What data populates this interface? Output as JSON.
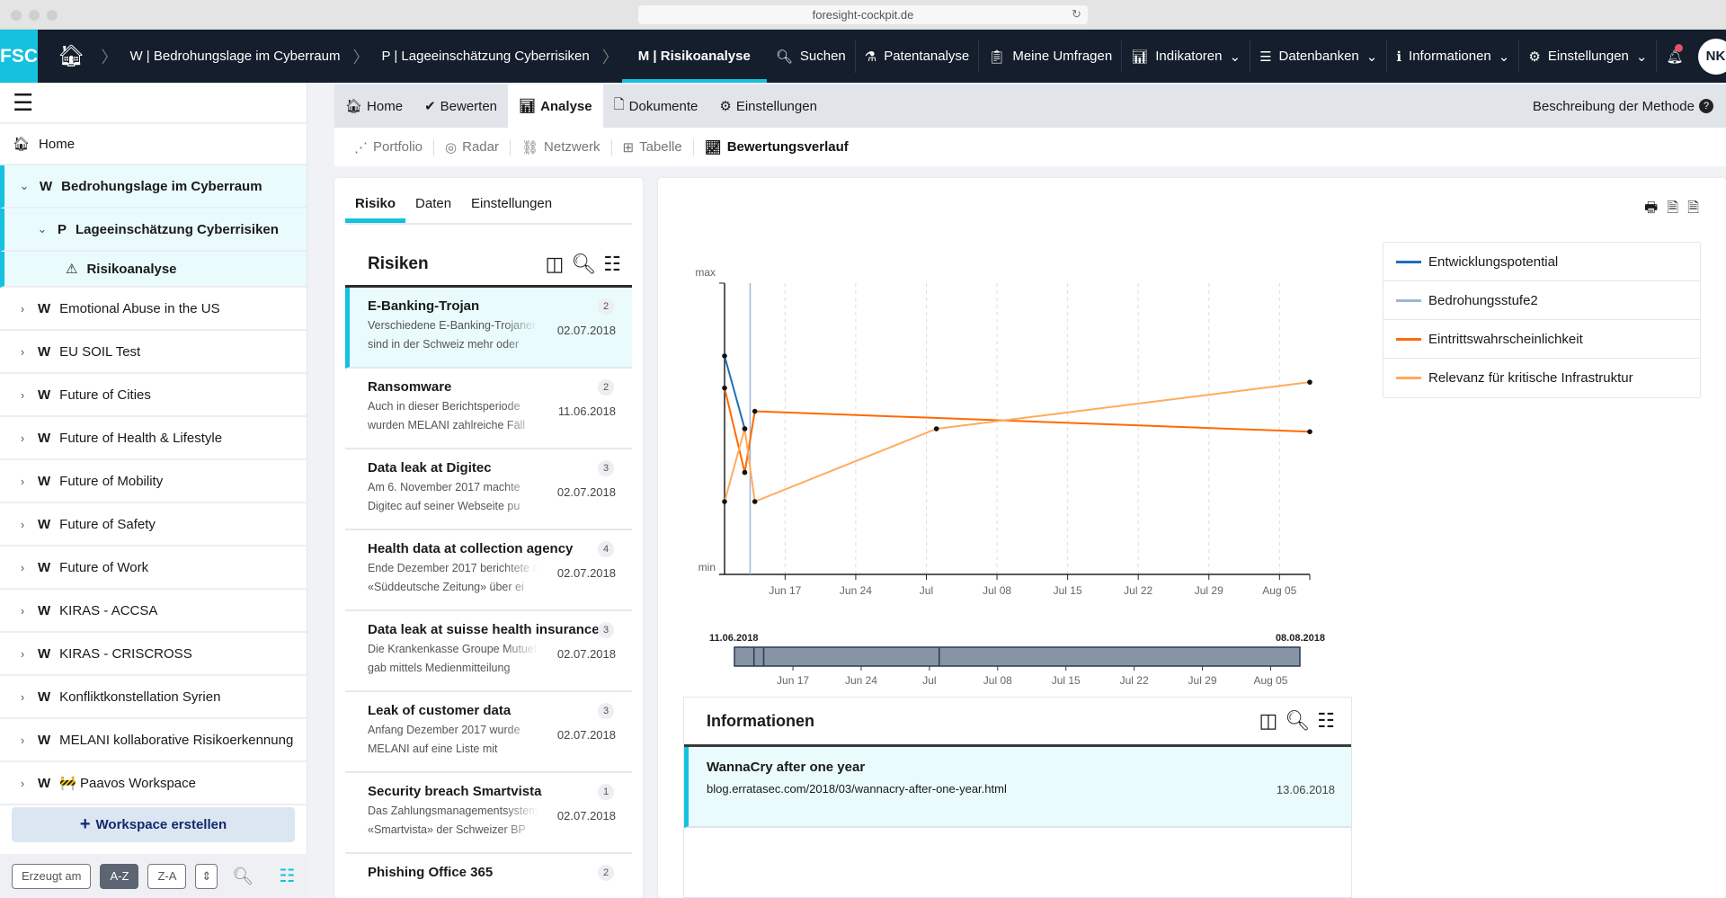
{
  "browser": {
    "url": "foresight-cockpit.de"
  },
  "nav": {
    "logo": "FSC",
    "breadcrumbs": [
      "W | Bedrohungslage im Cyberraum",
      "P | Lageeinschätzung Cyberrisiken",
      "M | Risikoanalyse"
    ],
    "items": [
      {
        "label": "Suchen",
        "icon": "search-icon"
      },
      {
        "label": "Patentanalyse",
        "icon": "flask-icon"
      },
      {
        "label": "Meine Umfragen",
        "icon": "clipboard-icon"
      },
      {
        "label": "Indikatoren",
        "icon": "bar-chart-icon",
        "dropdown": true
      },
      {
        "label": "Datenbanken",
        "icon": "database-icon",
        "dropdown": true
      },
      {
        "label": "Informationen",
        "icon": "info-icon",
        "dropdown": true
      },
      {
        "label": "Einstellungen",
        "icon": "gear-icon",
        "dropdown": true
      }
    ],
    "avatar": "NK",
    "accent": "#14c1df"
  },
  "sidebar": {
    "home": "Home",
    "tree": [
      {
        "prefix": "W",
        "label": "Bedrohungslage im Cyberraum"
      },
      {
        "prefix": "P",
        "label": "Lageeinschätzung Cyberrisiken"
      },
      {
        "label": "Risikoanalyse"
      }
    ],
    "workspaces": [
      "Emotional Abuse in the US",
      "EU SOIL Test",
      "Future of Cities",
      "Future of Health & Lifestyle",
      "Future of Mobility",
      "Future of Safety",
      "Future of Work",
      "KIRAS - ACCSA",
      "KIRAS - CRISCROSS",
      "Konfliktkonstellation Syrien",
      "MELANI kollaborative Risikoerkennung",
      "🚧 Paavos Workspace"
    ],
    "prefix": "W",
    "create": "Workspace erstellen",
    "sort": [
      "Erzeugt am",
      "A-Z",
      "Z-A"
    ]
  },
  "tabs": {
    "items": [
      "Home",
      "Bewerten",
      "Analyse",
      "Dokumente",
      "Einstellungen"
    ],
    "active": "Analyse",
    "help": "Beschreibung der Methode"
  },
  "subtabs": {
    "items": [
      "Portfolio",
      "Radar",
      "Netzwerk",
      "Tabelle",
      "Bewertungsverlauf"
    ],
    "active": "Bewertungsverlauf"
  },
  "left": {
    "tabs": [
      "Risiko",
      "Daten",
      "Einstellungen"
    ],
    "title": "Risiken",
    "risks": [
      {
        "title": "E-Banking-Trojan",
        "desc1": "Verschiedene E-Banking-Trojaner",
        "desc2": "sind in der Schweiz mehr oder",
        "date": "02.07.2018",
        "count": "2"
      },
      {
        "title": "Ransomware",
        "desc1": "Auch in dieser Berichtsperiode",
        "desc2": "wurden MELANI zahlreiche Fäll",
        "date": "11.06.2018",
        "count": "2"
      },
      {
        "title": "Data leak at Digitec",
        "desc1": "Am 6. November 2017 machte",
        "desc2": "Digitec auf seiner Webseite pu",
        "date": "02.07.2018",
        "count": "3"
      },
      {
        "title": "Health data at collection agency",
        "desc1": "Ende Dezember 2017 berichtete die",
        "desc2": "«Süddeutsche Zeitung» über ei",
        "date": "02.07.2018",
        "count": "4"
      },
      {
        "title": "Data leak at suisse health insurance",
        "desc1": "Die Krankenkasse Groupe Mutuel",
        "desc2": "gab mittels Medienmitteilung",
        "date": "02.07.2018",
        "count": "3"
      },
      {
        "title": "Leak of customer data",
        "desc1": "Anfang Dezember 2017 wurde",
        "desc2": "MELANI auf eine Liste mit",
        "date": "02.07.2018",
        "count": "3"
      },
      {
        "title": "Security breach Smartvista",
        "desc1": "Das Zahlungsmanagementsystem",
        "desc2": "«Smartvista» der Schweizer BP",
        "date": "02.07.2018",
        "count": "1"
      },
      {
        "title": "Phishing Office 365",
        "desc1": "",
        "desc2": "",
        "date": "",
        "count": "2"
      }
    ]
  },
  "chart_data": {
    "type": "line",
    "ylabels": {
      "max": "max",
      "min": "min"
    },
    "ylim": [
      0,
      1
    ],
    "xlim": [
      "2018-06-11",
      "2018-08-08"
    ],
    "xticks": [
      {
        "date": "2018-06-17",
        "label": "Jun 17"
      },
      {
        "date": "2018-06-24",
        "label": "Jun 24"
      },
      {
        "date": "2018-07-01",
        "label": "Jul"
      },
      {
        "date": "2018-07-08",
        "label": "Jul 08"
      },
      {
        "date": "2018-07-15",
        "label": "Jul 15"
      },
      {
        "date": "2018-07-22",
        "label": "Jul 22"
      },
      {
        "date": "2018-07-29",
        "label": "Jul 29"
      },
      {
        "date": "2018-08-05",
        "label": "Aug 05"
      }
    ],
    "grid": "vertical-dashed",
    "legend": "right",
    "series": [
      {
        "name": "Entwicklungspotential",
        "color": "#1f6fb4",
        "points": [
          [
            "2018-06-11",
            0.75
          ],
          [
            "2018-06-13",
            0.5
          ]
        ]
      },
      {
        "name": "Bedrohungsstufe2",
        "color": "#9ab6d8",
        "marker_date": "2018-06-13",
        "points": []
      },
      {
        "name": "Eintrittswahrscheinlichkeit",
        "color": "#ff6a00",
        "points": [
          [
            "2018-06-11",
            0.64
          ],
          [
            "2018-06-13",
            0.35
          ],
          [
            "2018-06-14",
            0.56
          ],
          [
            "2018-08-08",
            0.49
          ]
        ]
      },
      {
        "name": "Relevanz für kritische Infrastruktur",
        "color": "#ffab5c",
        "points": [
          [
            "2018-06-11",
            0.25
          ],
          [
            "2018-06-13",
            0.5
          ],
          [
            "2018-06-14",
            0.25
          ],
          [
            "2018-07-02",
            0.5
          ],
          [
            "2018-08-08",
            0.66
          ]
        ]
      }
    ],
    "navigator": {
      "start_label": "11.06.2018",
      "end_label": "08.08.2018",
      "markers": [
        "2018-06-13",
        "2018-06-14",
        "2018-07-02"
      ]
    }
  },
  "info": {
    "title": "Informationen",
    "item": {
      "title": "WannaCry after one year",
      "url": "blog.erratasec.com/2018/03/wannacry-after-one-year.html",
      "date": "13.06.2018"
    }
  }
}
